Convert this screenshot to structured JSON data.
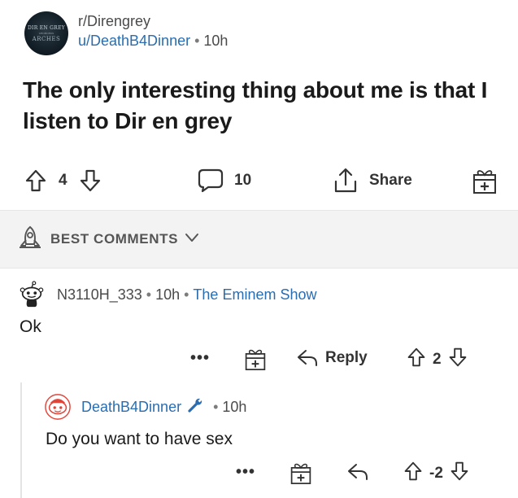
{
  "post": {
    "subreddit": "r/Direngrey",
    "author": "u/DeathB4Dinner",
    "separator": "•",
    "age": "10h",
    "avatar_text": [
      "DIR EN GREY",
      "UROBOROS",
      "ARCHES"
    ],
    "title": "The only interesting thing about me is that I listen to Dir en grey",
    "score": "4",
    "comment_count": "10",
    "share_label": "Share",
    "icons": {
      "upvote": "upvote-arrow-icon",
      "downvote": "downvote-arrow-icon",
      "comments": "comment-bubble-icon",
      "share": "share-icon",
      "award": "award-gift-icon"
    }
  },
  "sort": {
    "label": "BEST COMMENTS",
    "icons": {
      "rocket": "rocket-icon",
      "chevron": "chevron-down-icon"
    }
  },
  "comments": [
    {
      "author": "N3110H_333",
      "separator": "•",
      "age": "10h",
      "flair": "The Eminem Show",
      "body": "Ok",
      "more": "•••",
      "reply_label": "Reply",
      "score": "2"
    },
    {
      "author": "DeathB4Dinner",
      "separator": "•",
      "age": "10h",
      "body": "Do you want to have sex",
      "more": "•••",
      "score": "-2"
    }
  ],
  "colors": {
    "link_blue": "#2a6db0",
    "text": "#1a1a1b",
    "muted": "#4a4a4a",
    "sort_bar_bg": "#f3f3f4"
  }
}
